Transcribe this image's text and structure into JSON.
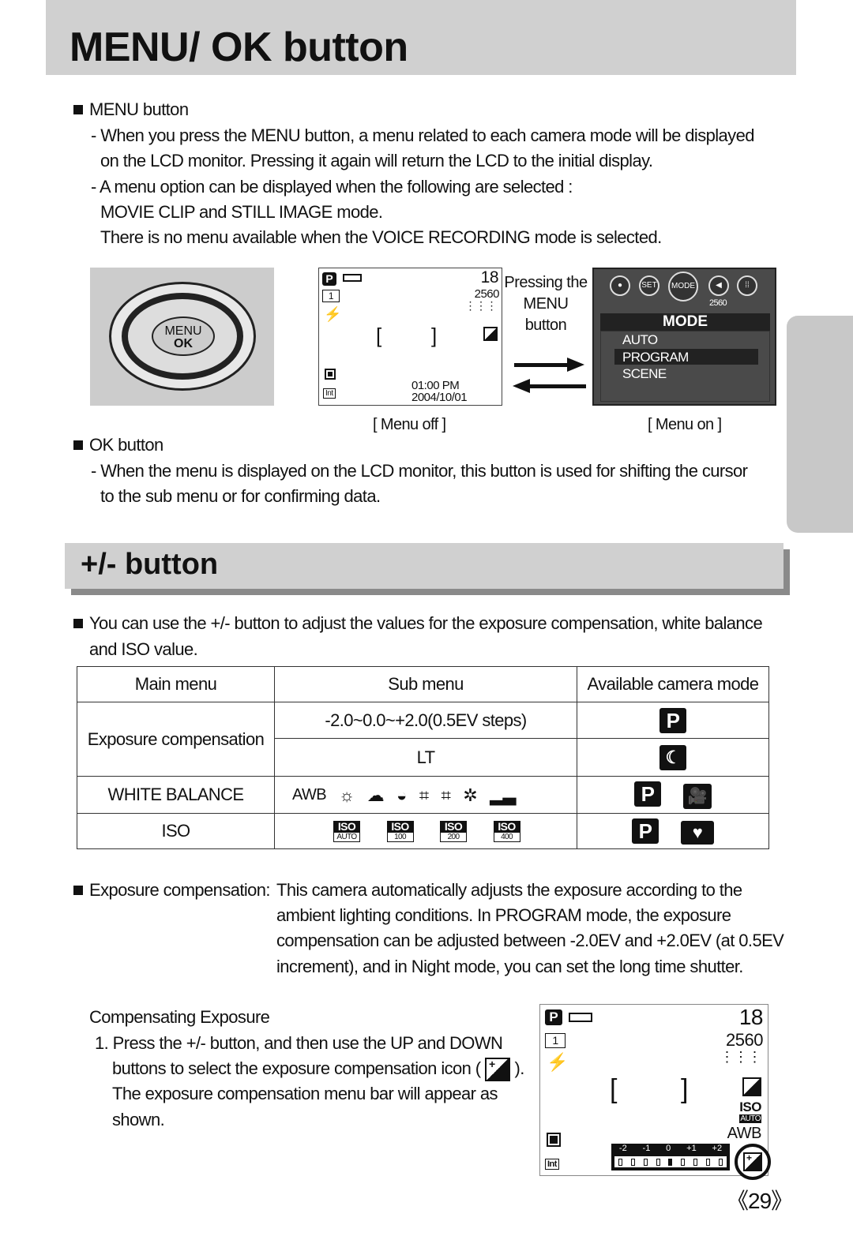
{
  "header": {
    "title": "MENU/ OK button"
  },
  "menu_section": {
    "heading": "MENU button",
    "lines": [
      "- When you press the MENU button, a menu related to each camera mode will be displayed",
      "on the LCD monitor. Pressing it again will return the LCD to the initial display.",
      "- A menu option can be displayed when the following are selected :",
      "MOVIE CLIP and STILL IMAGE mode.",
      "There is no menu available when the VOICE RECORDING mode is selected."
    ]
  },
  "dial": {
    "menu": "MENU",
    "ok": "OK"
  },
  "lcd_off": {
    "shots": "18",
    "resolution": "2560",
    "time": "01:00 PM",
    "date": "2004/10/01",
    "mode": "P",
    "frame": "1",
    "caption": "[ Menu off ]"
  },
  "pressing": [
    "Pressing the",
    "MENU",
    "button"
  ],
  "lcd_on": {
    "icons": [
      "SET",
      "MODE"
    ],
    "resolution": "2560",
    "title": "MODE",
    "items": [
      "AUTO",
      "PROGRAM",
      "SCENE"
    ],
    "selected": 1,
    "caption": "[ Menu on ]"
  },
  "ok_section": {
    "heading": "OK button",
    "lines": [
      "- When the menu is displayed on the LCD monitor, this button is used for shifting the cursor",
      "to the sub menu or for confirming data."
    ]
  },
  "pm_section": {
    "title": "+/- button",
    "intro": [
      "You can use the +/- button to adjust the values for the exposure compensation, white balance",
      "and ISO value."
    ]
  },
  "table": {
    "headers": [
      "Main menu",
      "Sub menu",
      "Available camera mode"
    ],
    "exposure": "Exposure compensation",
    "ev_range": "-2.0~0.0~+2.0(0.5EV steps)",
    "lt": "LT",
    "wb": "WHITE BALANCE",
    "awb": "AWB",
    "iso": "ISO",
    "iso_values": [
      "AUTO",
      "100",
      "200",
      "400"
    ],
    "mode_p": "P"
  },
  "exp_section": {
    "label": "Exposure compensation:",
    "lines": [
      "This camera automatically adjusts the exposure according to the",
      "ambient lighting conditions. In PROGRAM mode, the exposure",
      "compensation can be adjusted between -2.0EV and +2.0EV (at 0.5EV",
      "increment), and in Night mode, you can set the long time shutter."
    ]
  },
  "comp": {
    "title": "Compensating Exposure",
    "lines": [
      "1. Press the +/- button, and then use the UP and DOWN",
      "buttons to select the exposure compensation icon (",
      ").",
      "The exposure compensation menu bar will appear as",
      "shown."
    ]
  },
  "lcd_comp": {
    "shots": "18",
    "resolution": "2560",
    "iso": "ISO",
    "iso_mode": "AUTO",
    "awb": "AWB",
    "scale": [
      "-2",
      "-1",
      "0",
      "+1",
      "+2"
    ],
    "selected_step": 4
  },
  "page": {
    "number": "《29》"
  }
}
